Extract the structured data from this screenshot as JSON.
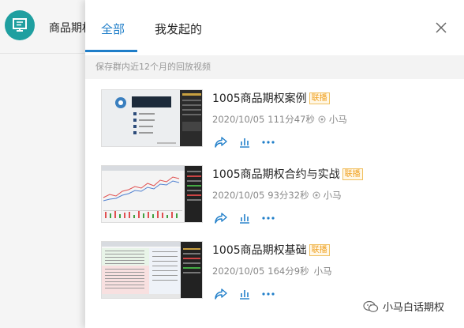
{
  "app": {
    "chat_title": "商品期权"
  },
  "tabs": [
    {
      "label": "全部",
      "active": true
    },
    {
      "label": "我发起的",
      "active": false
    }
  ],
  "notice": "保存群内近12个月的回放视频",
  "videos": [
    {
      "title": "1005商品期权案例",
      "badge": "联播",
      "date": "2020/10/05",
      "duration": "111分47秒",
      "author": "小马"
    },
    {
      "title": "1005商品期权合约与实战",
      "badge": "联播",
      "date": "2020/10/05",
      "duration": "93分32秒",
      "author": "小马"
    },
    {
      "title": "1005商品期权基础",
      "badge": "联播",
      "date": "2020/10/05",
      "duration": "164分9秒",
      "author": "小马"
    }
  ],
  "thumb1_lines": [
    "从期权入手",
    "1 交易期权",
    "2 期权策略",
    "3 期权交易",
    "4 交易风险"
  ],
  "watermark": "小马白话期权",
  "colors": {
    "accent": "#1f7ec9",
    "avatar": "#1f9fa0",
    "badge": "#f0a020"
  }
}
